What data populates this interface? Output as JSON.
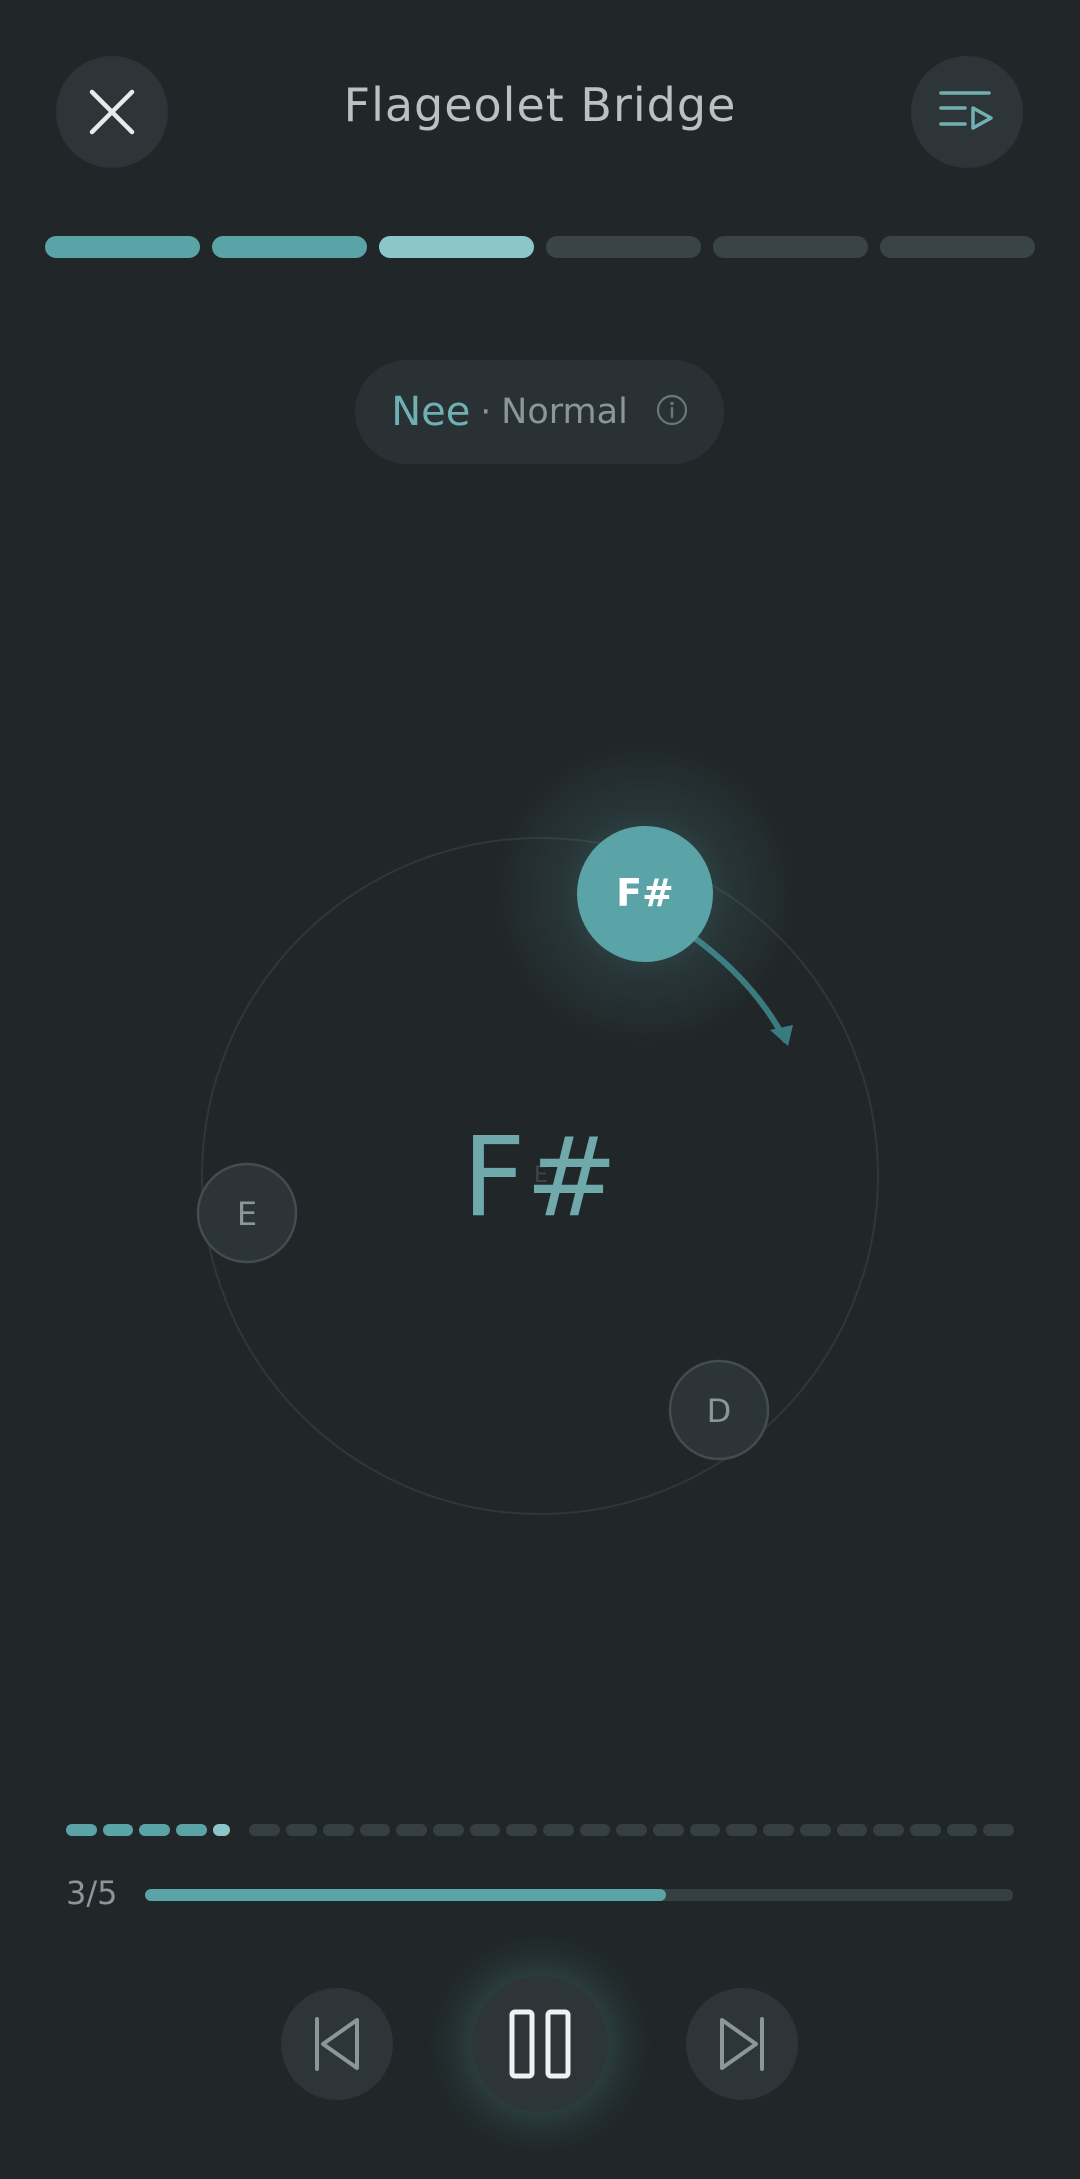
{
  "header": {
    "title": "Flageolet Bridge",
    "close_icon": "close-icon",
    "queue_icon": "playlist-play-icon"
  },
  "progress_segments": {
    "total": 6,
    "completed": 2,
    "current": 3
  },
  "mode_pill": {
    "name": "Nee",
    "separator": "·",
    "mode": "Normal",
    "info_icon": "info-icon"
  },
  "dial": {
    "active_note": "F#",
    "center_note": "F#",
    "faint_note": "E",
    "other_notes": [
      "E",
      "D"
    ],
    "direction_icon": "arrow-clockwise-icon"
  },
  "step_dots": {
    "total": 26,
    "completed": 4,
    "current": 5
  },
  "playback": {
    "count": "3/5",
    "progress": 0.6
  },
  "controls": {
    "prev_icon": "skip-previous-icon",
    "pause_icon": "pause-icon",
    "next_icon": "skip-next-icon"
  },
  "colors": {
    "background": "#212729",
    "accent": "#5aa3a7",
    "accent_light": "#8dc6c8",
    "inactive": "#3a4446"
  }
}
